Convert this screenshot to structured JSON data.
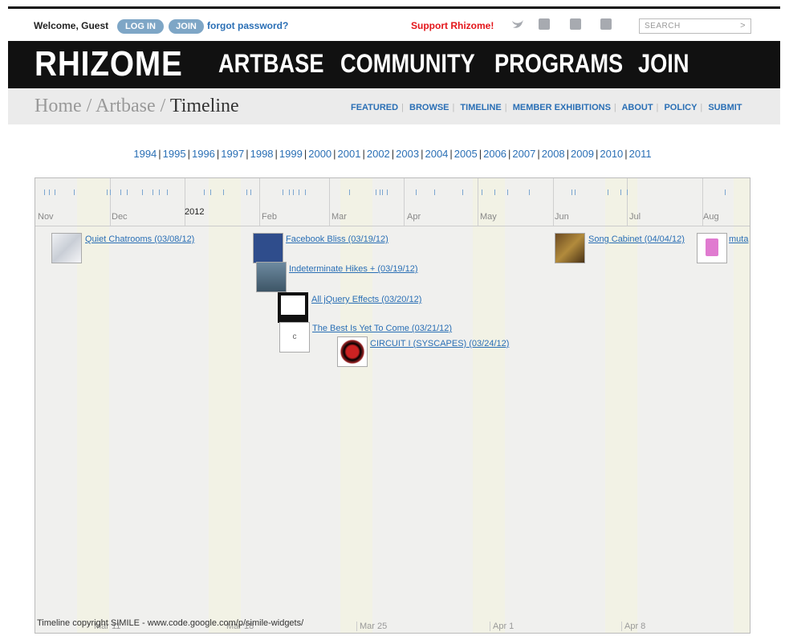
{
  "topbar": {
    "welcome": "Welcome, Guest",
    "login": "LOG IN",
    "join": "JOIN",
    "forgot": "forgot password?",
    "support": "Support Rhizome!",
    "search_placeholder": "SEARCH",
    "search_go": ">"
  },
  "nav": {
    "logo": "RHIZOME",
    "items": [
      "ARTBASE",
      "COMMUNITY",
      "PROGRAMS",
      "JOIN"
    ]
  },
  "breadcrumb": {
    "home": "Home",
    "sep": " / ",
    "artbase": "Artbase",
    "current": "Timeline"
  },
  "subnav": [
    "FEATURED",
    "BROWSE",
    "TIMELINE",
    "MEMBER EXHIBITIONS",
    "ABOUT",
    "POLICY",
    "SUBMIT"
  ],
  "years": [
    "1994",
    "1995",
    "1996",
    "1997",
    "1998",
    "1999",
    "2000",
    "2001",
    "2002",
    "2003",
    "2004",
    "2005",
    "2006",
    "2007",
    "2008",
    "2009",
    "2010",
    "2011"
  ],
  "timeline": {
    "year_label": "2012",
    "months": [
      "Nov",
      "Dec",
      "Feb",
      "Mar",
      "Apr",
      "May",
      "Jun",
      "Jul",
      "Aug"
    ],
    "events": [
      "Quiet Chatrooms (03/08/12)",
      "Facebook Bliss (03/19/12)",
      "Indeterminate Hikes + (03/19/12)",
      "All jQuery Effects (03/20/12)",
      "The Best Is Yet To Come (03/21/12)",
      "CIRCUIT I (SYSCAPES) (03/24/12)",
      "Song Cabinet (04/04/12)",
      "muta"
    ],
    "bottom_dates": [
      "Mar 11",
      "Mar 18",
      "Mar 25",
      "Apr 1",
      "Apr 8"
    ],
    "copyright": "Timeline copyright SIMILE - www.code.google.com/p/simile-widgets/"
  }
}
